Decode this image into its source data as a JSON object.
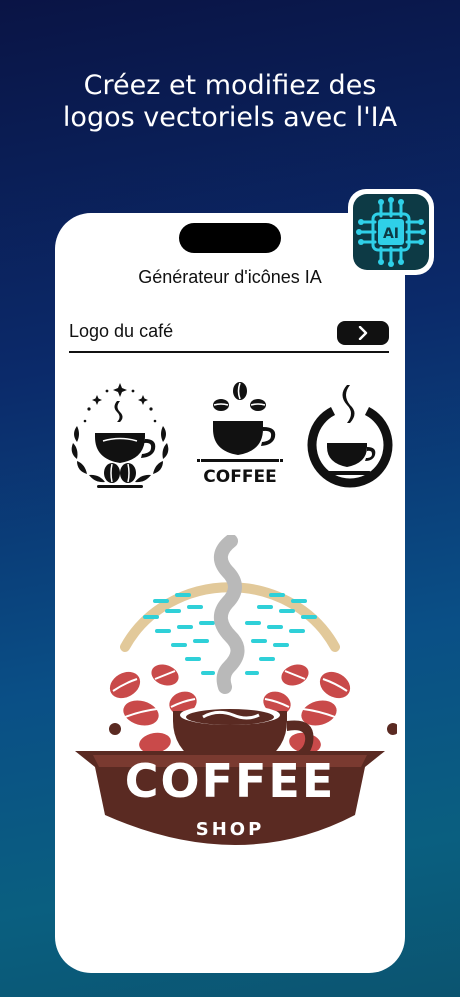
{
  "headline": {
    "line1": "Créez et modifiez des",
    "line2": "logos vectoriels avec l'IA"
  },
  "app": {
    "title": "Générateur d'icônes IA",
    "prompt_value": "Logo du café",
    "submit_icon": "chevron-right-icon"
  },
  "thumbnails": [
    {
      "name": "laurel-coffee-cup-logo"
    },
    {
      "name": "coffee-beans-cup-logo",
      "label": "COFFEE"
    },
    {
      "name": "circle-steam-cup-logo"
    }
  ],
  "main_logo": {
    "word": "COFFEE",
    "subword": "SHOP",
    "colors": {
      "brown": "#5a2a22",
      "red": "#c94a4a",
      "teal": "#2fd0d8",
      "tan": "#e2c99a",
      "steam": "#b9b9b9"
    }
  },
  "badge": {
    "label": "AI",
    "icon": "ai-chip-icon",
    "color": "#2fd0e8"
  }
}
